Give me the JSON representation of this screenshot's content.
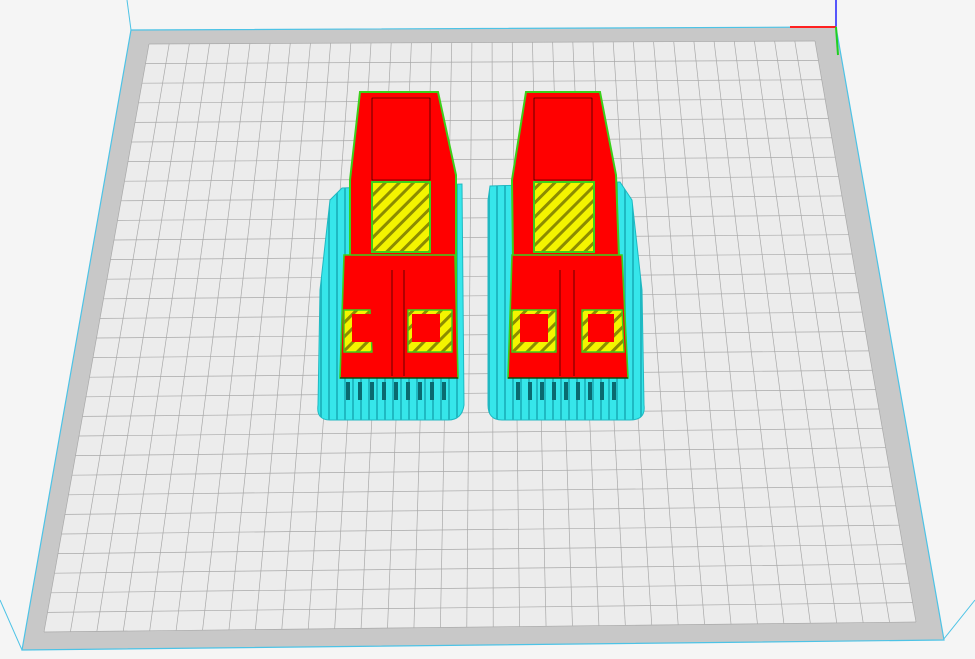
{
  "viewport": {
    "background": "#f5f5f5",
    "colors": {
      "bed_surface": "#ececec",
      "bed_border": "#c8c8c8",
      "bed_outline": "#4dc3e6",
      "grid_line": "#a9a9a9",
      "support": "#36e6ea",
      "support_dark": "#1fb9c2",
      "wall_outer": "#ff0000",
      "wall_inner": "#3ccf1a",
      "infill": "#f4f400",
      "infill_dark": "#8c8c00",
      "axis_x": "#ff2020",
      "axis_y": "#20d020",
      "axis_z": "#2020ff"
    }
  }
}
